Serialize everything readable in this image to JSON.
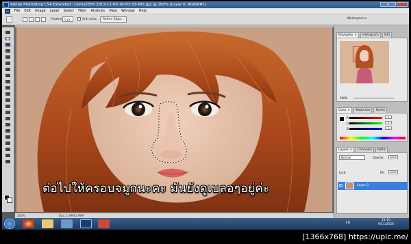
{
  "window": {
    "title": "Adobe Photoshop CS4 Extended - [Sims2EP9 2013-11-09 18-50-33-895.jpg @ 200% (Layer 0, RGB/8#)]"
  },
  "menu": {
    "ps_logo": "Ps",
    "items": [
      "File",
      "Edit",
      "Image",
      "Layer",
      "Select",
      "Filter",
      "Analysis",
      "View",
      "Window",
      "Help"
    ]
  },
  "options_bar": {
    "feather_label": "Feather:",
    "feather_value": "0 px",
    "antialias_label": "Anti-alias",
    "refine_edge_label": "Refine Edge...",
    "workspace_label": "Workspace ▾"
  },
  "document": {
    "subtitle": "ต่อไปให้ครอบจมูกนะคะ มันยังดูเบลอๆอยู่ค่ะ",
    "zoom": "200%",
    "doc_info": "Doc: 1.99M/2.99M"
  },
  "navigator": {
    "tabs": [
      "Navigator ×",
      "Histogram",
      "Info"
    ],
    "zoom": "200%"
  },
  "color": {
    "tabs": [
      "Color ×",
      "Swatches",
      "Styles"
    ],
    "channels": [
      {
        "name": "R",
        "value": "0"
      },
      {
        "name": "G",
        "value": "0"
      },
      {
        "name": "B",
        "value": "0"
      }
    ]
  },
  "layers": {
    "tabs": [
      "Layers ×",
      "Channels",
      "Paths"
    ],
    "blend_mode": "Normal",
    "opacity_label": "Opacity:",
    "opacity": "100%",
    "fill_label": "Fill:",
    "fill": "100%",
    "lock_label": "Lock:",
    "layer_name": "Layer 0"
  },
  "taskbar": {
    "language": "EN",
    "time": "21:10",
    "date": "9/11/2556"
  },
  "watermark": "[1366x768] https://upic.me/",
  "colors": {
    "selection_blue": "#3b7fdc",
    "hair": "#b8531c",
    "skin": "#e3c0aa"
  }
}
